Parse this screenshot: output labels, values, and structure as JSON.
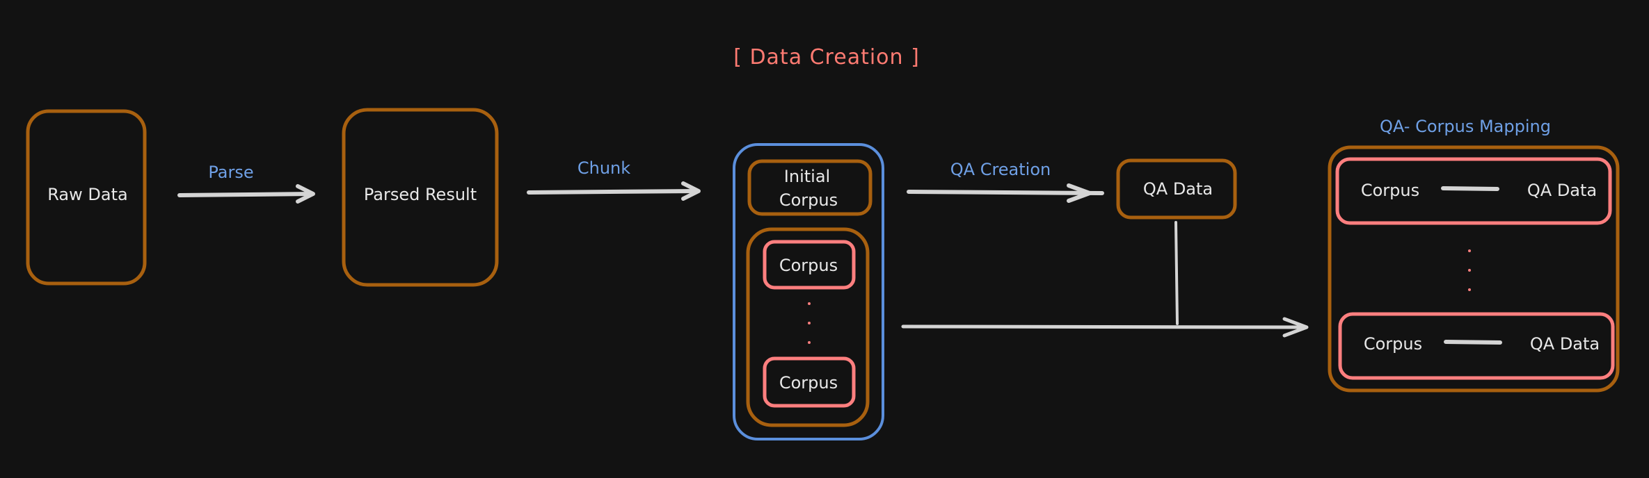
{
  "title": "[ Data Creation ]",
  "colors": {
    "background": "#121212",
    "box_orange": "#a8600f",
    "box_pink": "#ff7f7f",
    "box_blue": "#5b8fdc",
    "label_blue": "#6fa0e6",
    "text": "#e8e8e8",
    "arrow": "#d4d4d4",
    "title": "#ff7b72"
  },
  "nodes": {
    "raw_data": "Raw Data",
    "parsed_result": "Parsed Result",
    "initial_corpus_line1": "Initial",
    "initial_corpus_line2": "Corpus",
    "corpus_top": "Corpus",
    "corpus_bottom": "Corpus",
    "qa_data": "QA Data"
  },
  "edges": {
    "parse": "Parse",
    "chunk": "Chunk",
    "qa_creation": "QA Creation"
  },
  "mapping": {
    "title": "QA- Corpus Mapping",
    "rows": [
      {
        "left": "Corpus",
        "right": "QA Data"
      },
      {
        "left": "Corpus",
        "right": "QA Data"
      }
    ]
  },
  "ellipsis": "⋮"
}
